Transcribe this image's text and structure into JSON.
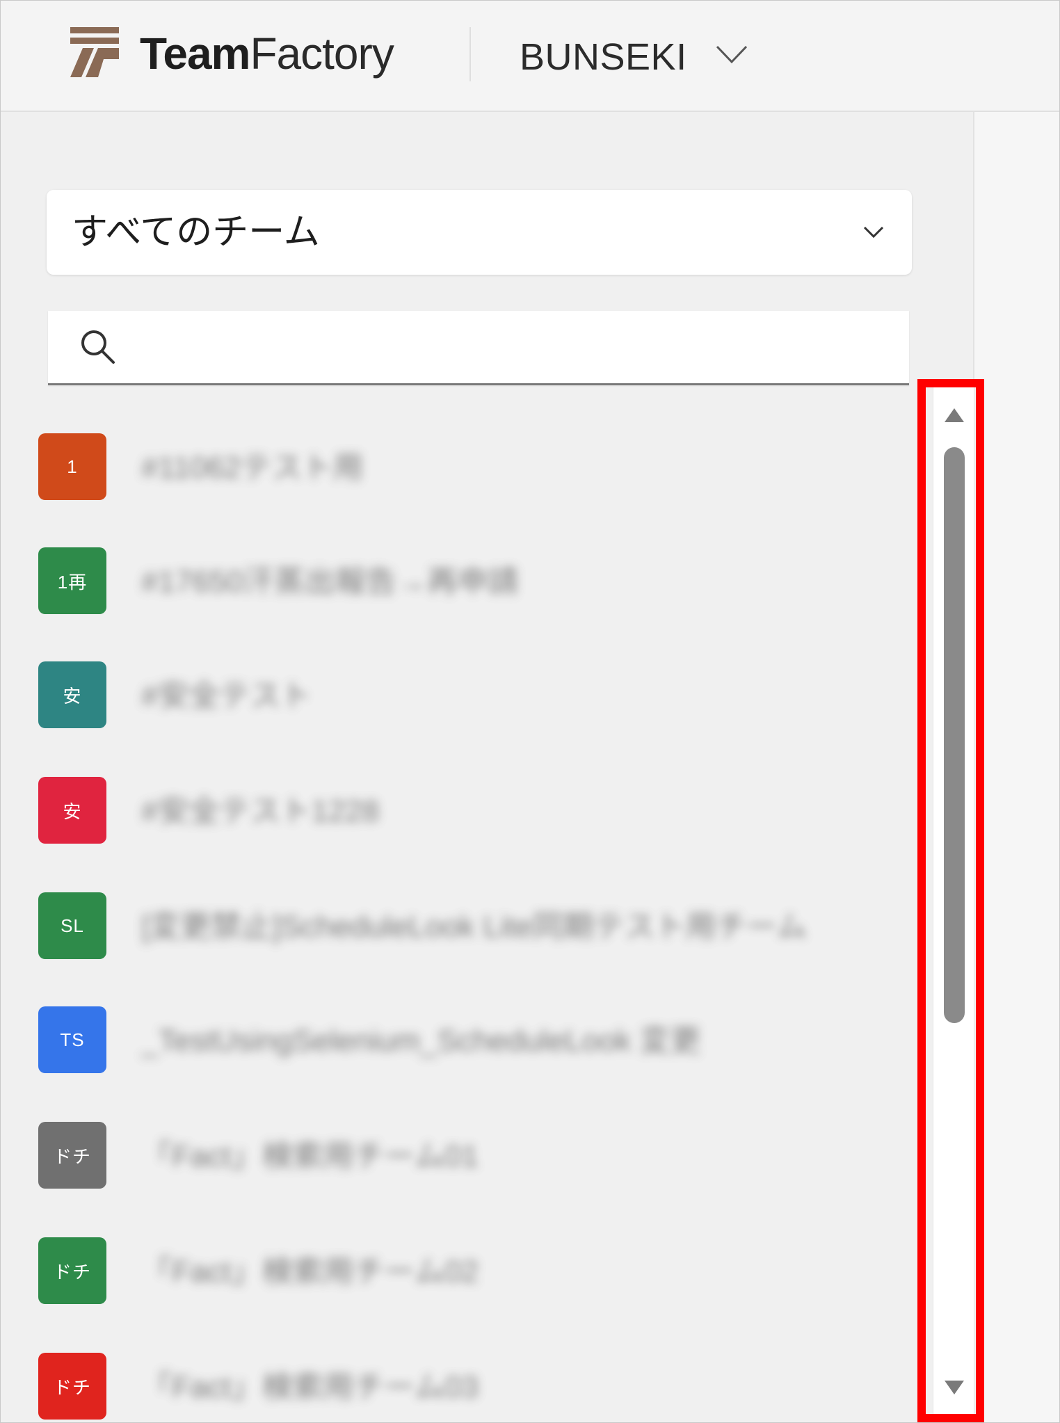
{
  "header": {
    "brand_bold": "Team",
    "brand_regular": "Factory",
    "workspace": "BUNSEKI"
  },
  "team_filter": {
    "selected": "すべてのチーム"
  },
  "search": {
    "placeholder": "",
    "value": ""
  },
  "teams": [
    {
      "initials": "1",
      "color": "#d04a1a",
      "name": "#11062テスト用"
    },
    {
      "initials": "1再",
      "color": "#2e8b4a",
      "name": "#17650汗蒸出報告→再申請"
    },
    {
      "initials": "安",
      "color": "#2e8583",
      "name": "#安全テスト"
    },
    {
      "initials": "安",
      "color": "#e0243f",
      "name": "#安全テスト1228"
    },
    {
      "initials": "SL",
      "color": "#2e8b4a",
      "name": "[変更禁止]ScheduleLook Lite同期テスト用チーム"
    },
    {
      "initials": "TS",
      "color": "#3575ea",
      "name": "_TestUsingSelenium_ScheduleLook 変更"
    },
    {
      "initials": "ドチ",
      "color": "#707070",
      "name": "「Fact」検索用チーム01"
    },
    {
      "initials": "ドチ",
      "color": "#2e8b4a",
      "name": "「Fact」検索用チーム02"
    },
    {
      "initials": "ドチ",
      "color": "#e0241e",
      "name": "「Fact」検索用チーム03"
    }
  ],
  "colors": {
    "highlight": "#ff0000",
    "scroll_thumb": "#8a8a8a",
    "logo": "#8a6a55"
  }
}
